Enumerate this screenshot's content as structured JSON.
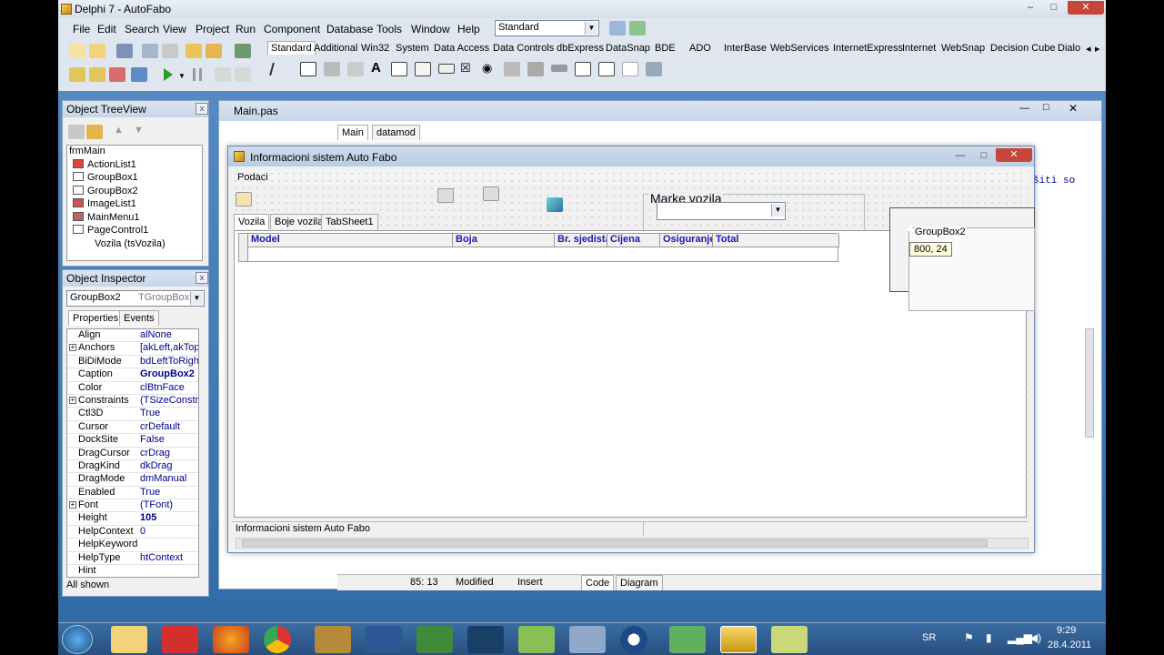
{
  "window": {
    "title": "Delphi 7 - AutoFabo",
    "min": "–",
    "max": "□",
    "close": "✕"
  },
  "menu": [
    "File",
    "Edit",
    "Search",
    "View",
    "Project",
    "Run",
    "Component",
    "Database",
    "Tools",
    "Window",
    "Help"
  ],
  "desktop_combo": "Standard",
  "palette_tabs": [
    "Standard",
    "Additional",
    "Win32",
    "System",
    "Data Access",
    "Data Controls",
    "dbExpress",
    "DataSnap",
    "BDE",
    "ADO",
    "InterBase",
    "WebServices",
    "InternetExpress",
    "Internet",
    "WebSnap",
    "Decision Cube",
    "Dialo"
  ],
  "palette_scroll": [
    "◂",
    "▸"
  ],
  "object_treeview": {
    "title": "Object TreeView",
    "close": "x",
    "items": [
      "frmMain",
      "ActionList1",
      "GroupBox1",
      "GroupBox2",
      "ImageList1",
      "MainMenu1",
      "PageControl1",
      "Vozila (tsVozila)"
    ]
  },
  "object_inspector": {
    "title": "Object Inspector",
    "close": "x",
    "selector_name": "GroupBox2",
    "selector_type": "TGroupBox",
    "tabs": [
      "Properties",
      "Events"
    ],
    "rows": [
      {
        "key": "Align",
        "value": "alNone",
        "plus": ""
      },
      {
        "key": "Anchors",
        "value": "[akLeft,akTop",
        "plus": "+"
      },
      {
        "key": "BiDiMode",
        "value": "bdLeftToRigh",
        "plus": ""
      },
      {
        "key": "Caption",
        "value": "GroupBox2",
        "plus": ""
      },
      {
        "key": "Color",
        "value": "clBtnFace",
        "plus": ""
      },
      {
        "key": "Constraints",
        "value": "(TSizeConstra",
        "plus": "+"
      },
      {
        "key": "Ctl3D",
        "value": "True",
        "plus": ""
      },
      {
        "key": "Cursor",
        "value": "crDefault",
        "plus": ""
      },
      {
        "key": "DockSite",
        "value": "False",
        "plus": ""
      },
      {
        "key": "DragCursor",
        "value": "crDrag",
        "plus": ""
      },
      {
        "key": "DragKind",
        "value": "dkDrag",
        "plus": ""
      },
      {
        "key": "DragMode",
        "value": "dmManual",
        "plus": ""
      },
      {
        "key": "Enabled",
        "value": "True",
        "plus": ""
      },
      {
        "key": "Font",
        "value": "(TFont)",
        "plus": "+"
      },
      {
        "key": "Height",
        "value": "105",
        "plus": ""
      },
      {
        "key": "HelpContext",
        "value": "0",
        "plus": ""
      },
      {
        "key": "HelpKeyword",
        "value": "",
        "plus": ""
      },
      {
        "key": "HelpType",
        "value": "htContext",
        "plus": ""
      },
      {
        "key": "Hint",
        "value": "",
        "plus": ""
      }
    ],
    "status": "All shown"
  },
  "editor": {
    "tab": "Main.pas",
    "unit_tabs": [
      "Main",
      "datamod"
    ],
    "code_fragment": "šiti so",
    "status_pos": "85: 13",
    "status_mod": "Modified",
    "status_ins": "Insert",
    "bottom_tabs": [
      "Code",
      "Diagram"
    ]
  },
  "form": {
    "title": "Informacioni sistem Auto Fabo",
    "menu": "Podaci",
    "label_marke": "Marke vozila",
    "tabs": [
      "Vozila",
      "Boje vozila",
      "TabSheet1"
    ],
    "grid_columns": [
      "Model",
      "Boja",
      "Br. sjedista",
      "Cijena",
      "Osiguranje",
      "Total"
    ],
    "status": "Informacioni sistem Auto Fabo",
    "groupbox_caption": "GroupBox2",
    "size_hint": "800, 24"
  },
  "tray": {
    "lang": "SR",
    "time": "9:29",
    "date": "28.4.2011"
  },
  "taskbar_icons": [
    "start",
    "explorer",
    "mts",
    "firefox",
    "chrome",
    "winrar",
    "word",
    "dreamweaver",
    "photoshop",
    "app",
    "settings",
    "vw",
    "people",
    "delphi",
    "notes"
  ]
}
